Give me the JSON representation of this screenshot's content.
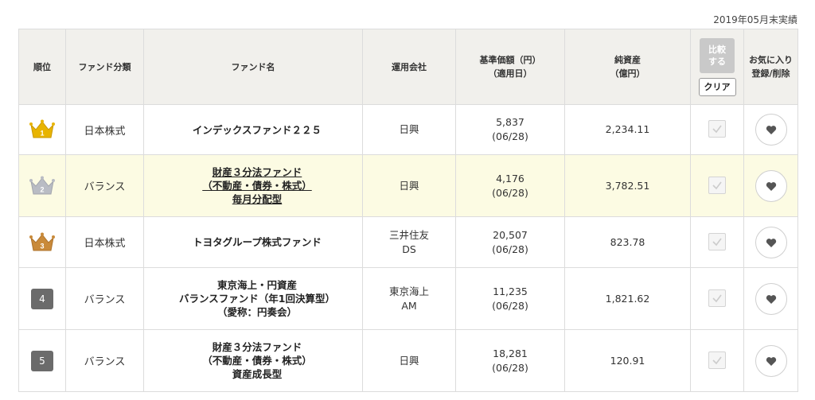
{
  "note": "2019年05月末実績",
  "headers": {
    "rank": "順位",
    "category": "ファンド分類",
    "fund_name": "ファンド名",
    "company": "運用会社",
    "price_1": "基準価額（円）",
    "price_2": "（適用日）",
    "assets_1": "純資産",
    "assets_2": "（億円）",
    "compare_1": "比較",
    "compare_2": "する",
    "clear": "クリア",
    "fav_1": "お気に入り",
    "fav_2": "登録/削除"
  },
  "rows": [
    {
      "rank": "1",
      "rank_icon": "gold-crown-icon",
      "category": "日本株式",
      "name": [
        "インデックスファンド２２５"
      ],
      "company": [
        "日興"
      ],
      "price": "5,837",
      "date": "(06/28)",
      "assets": "2,234.11"
    },
    {
      "rank": "2",
      "rank_icon": "silver-crown-icon",
      "category": "バランス",
      "name": [
        "財産３分法ファンド",
        "（不動産・債券・株式）",
        "毎月分配型"
      ],
      "company": [
        "日興"
      ],
      "price": "4,176",
      "date": "(06/28)",
      "assets": "3,782.51"
    },
    {
      "rank": "3",
      "rank_icon": "bronze-crown-icon",
      "category": "日本株式",
      "name": [
        "トヨタグループ株式ファンド"
      ],
      "company": [
        "三井住友",
        "DS"
      ],
      "price": "20,507",
      "date": "(06/28)",
      "assets": "823.78"
    },
    {
      "rank": "4",
      "category": "バランス",
      "name": [
        "東京海上・円資産",
        "バランスファンド（年1回決算型）",
        "（愛称：円奏会）"
      ],
      "company": [
        "東京海上",
        "AM"
      ],
      "price": "11,235",
      "date": "(06/28)",
      "assets": "1,821.62"
    },
    {
      "rank": "5",
      "category": "バランス",
      "name": [
        "財産３分法ファンド",
        "（不動産・債券・株式）",
        "資産成長型"
      ],
      "company": [
        "日興"
      ],
      "price": "18,281",
      "date": "(06/28)",
      "assets": "120.91"
    }
  ],
  "colors": {
    "gold": "#e8b400",
    "silver": "#b9bcc4",
    "bronze": "#c98a3a",
    "highlight_row": "#fcfbe3",
    "header_bg": "#f1f0ec",
    "heart": "#555555"
  }
}
